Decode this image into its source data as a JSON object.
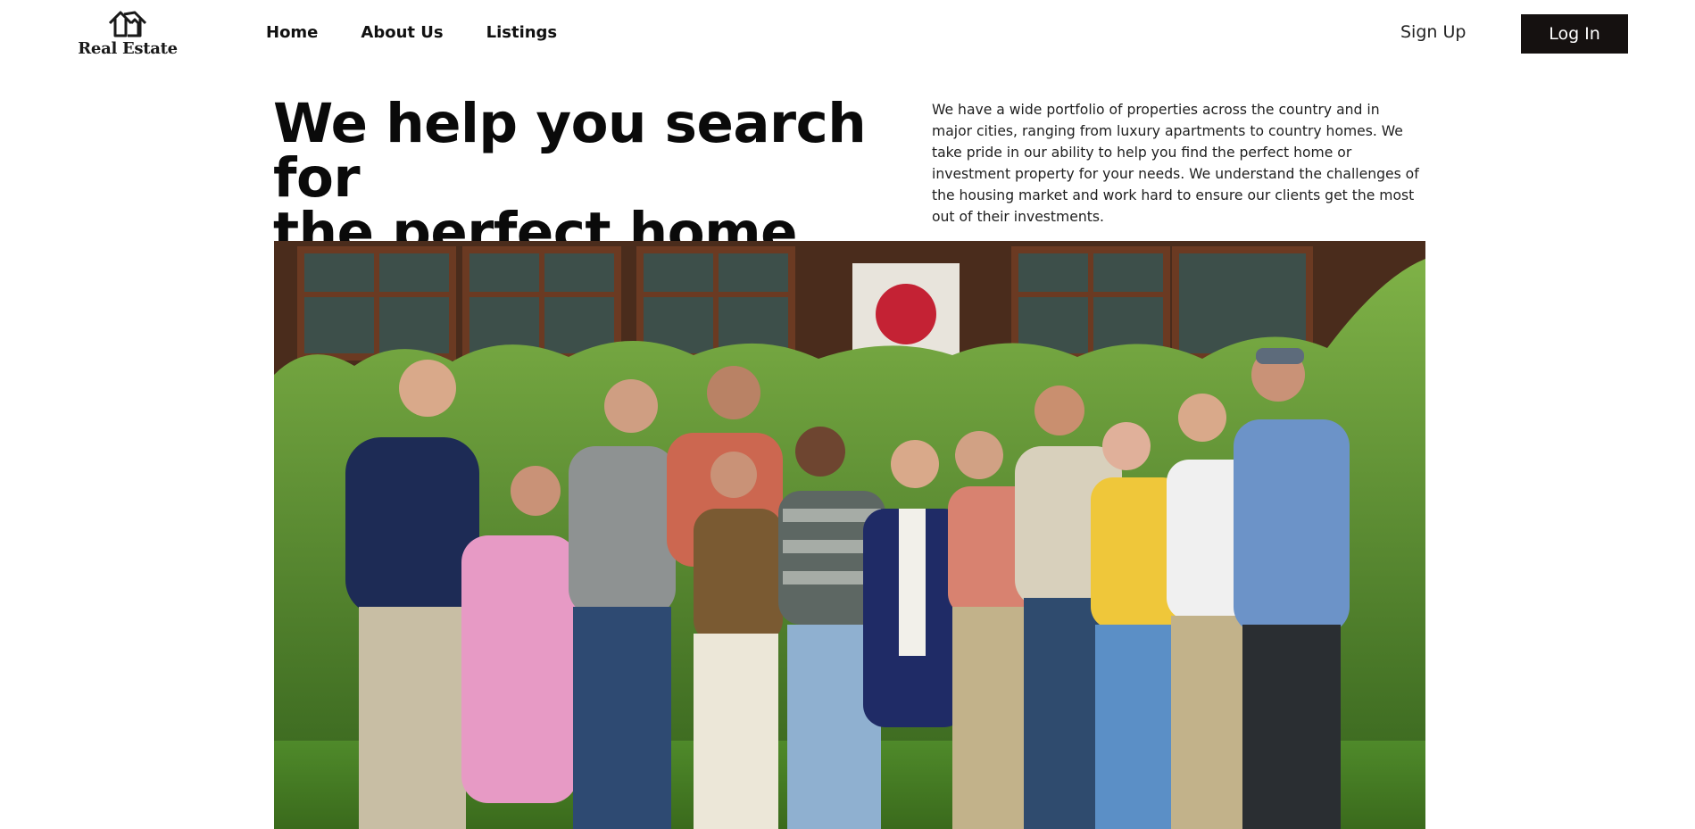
{
  "header": {
    "logo_text": "Real Estate",
    "nav": {
      "home": "Home",
      "about": "About Us",
      "listings": "Listings"
    },
    "sign_up": "Sign Up",
    "log_in": "Log In"
  },
  "hero": {
    "title_line1": "We help you search for",
    "title_line2": "the perfect home",
    "description": "We have a wide portfolio of properties across the country and in major cities, ranging from luxury apartments to country homes. We take pride in our ability to help you find the perfect home or investment property for your needs. We understand the challenges of the housing market and work hard to ensure our clients get the most out of their investments."
  },
  "colors": {
    "login_bg": "#151110",
    "text": "#111111",
    "background": "#ffffff"
  },
  "icons": {
    "logo": "house-outline-icon"
  }
}
